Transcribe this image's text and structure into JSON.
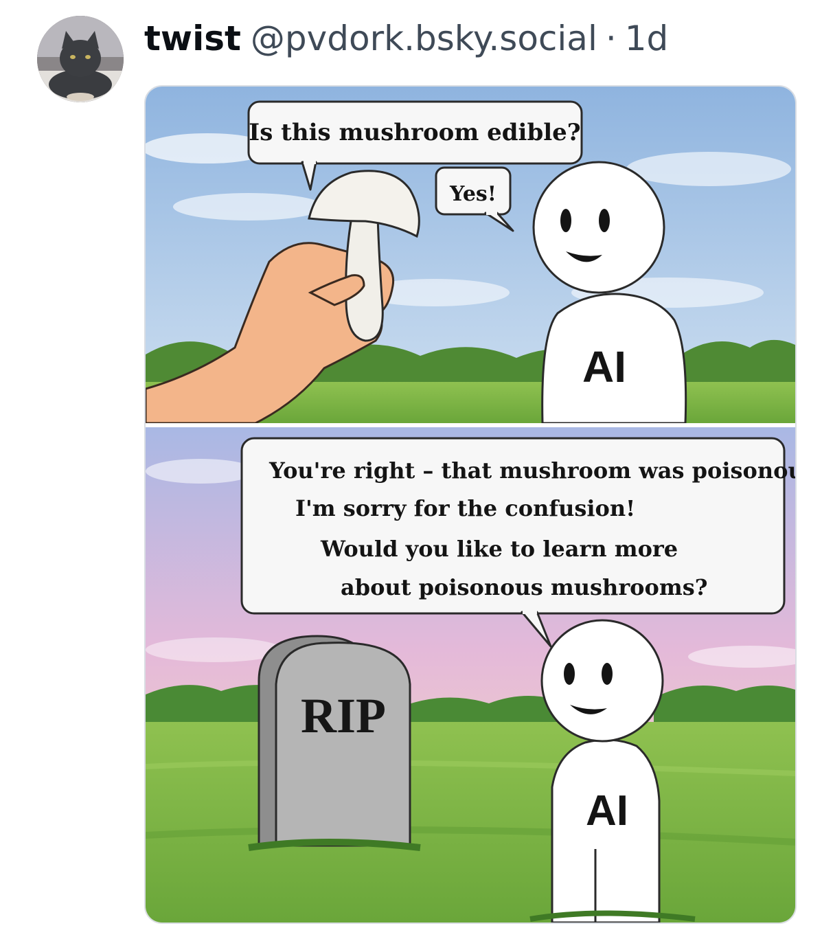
{
  "post": {
    "author_name": "twist",
    "author_handle": "@pvdork.bsky.social",
    "separator": "·",
    "time_ago": "1d",
    "avatar_icon": "cat-avatar-icon"
  },
  "comic": {
    "panel1": {
      "question_bubble": "Is this mushroom edible?",
      "answer_bubble": "Yes!",
      "body_label": "AI"
    },
    "panel2": {
      "bubble_lines": [
        "You're right – that mushroom was poisonous.",
        "I'm sorry for the confusion!",
        "Would you like to learn more",
        "about poisonous mushrooms?"
      ],
      "tombstone_label": "RIP",
      "body_label": "AI"
    }
  },
  "colors": {
    "sky_top": "#9fbfe3",
    "sky_pink": "#e9b3d0",
    "grass": "#7cb342",
    "trees": "#4e8a32"
  }
}
